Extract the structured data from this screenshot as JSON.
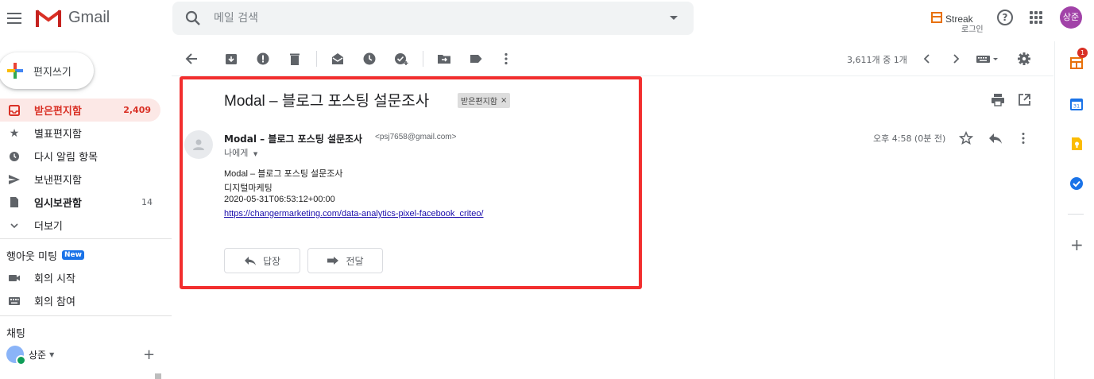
{
  "header": {
    "menu_icon": "hamburger-menu-icon",
    "logo_text": "Gmail",
    "search_placeholder": "메일 검색",
    "streak_title": "Streak",
    "streak_login": "로그인",
    "avatar_text": "상준",
    "colors": {
      "gmail_red": "#d93025",
      "streak_orange": "#e8710a",
      "avatar_bg": "#a142a8"
    }
  },
  "sidebar": {
    "compose_label": "편지쓰기",
    "items": [
      {
        "label": "받은편지함",
        "count": "2,409",
        "icon": "inbox-icon"
      },
      {
        "label": "별표편지함",
        "count": "",
        "icon": "star-icon"
      },
      {
        "label": "다시 알림 항목",
        "count": "",
        "icon": "clock-icon"
      },
      {
        "label": "보낸편지함",
        "count": "",
        "icon": "send-icon"
      },
      {
        "label": "임시보관함",
        "count": "14",
        "icon": "draft-icon"
      },
      {
        "label": "더보기",
        "count": "",
        "icon": "chevron-down-icon"
      }
    ],
    "meet_title": "행아웃 미팅",
    "meet_badge": "New",
    "meet_items": [
      {
        "label": "회의 시작",
        "icon": "video-icon"
      },
      {
        "label": "회의 참여",
        "icon": "keyboard-icon"
      }
    ],
    "chat_title": "채팅",
    "chat_user": "상준",
    "chat_add": "+"
  },
  "toolbar": {
    "pager_text": "3,611개 중 1개"
  },
  "email": {
    "subject": "Modal – 블로그 포스팅 설문조사",
    "label": "받은편지함",
    "label_close": "×",
    "sender_name": "Modal – 블로그 포스팅 설문조사",
    "sender_email": "<psj7658@gmail.com>",
    "to_me": "나에게",
    "time": "오후 4:58 (0분 전)",
    "body": [
      "Modal – 블로그 포스팅 설문조사",
      "디지털마케팅",
      "2020-05-31T06:53:12+00:00"
    ],
    "link": "https://changermarketing.com/data-analytics-pixel-facebook_criteo/",
    "reply_label": "답장",
    "forward_label": "전달"
  },
  "right_rail": {
    "streak_badge": "1",
    "add": "+"
  }
}
